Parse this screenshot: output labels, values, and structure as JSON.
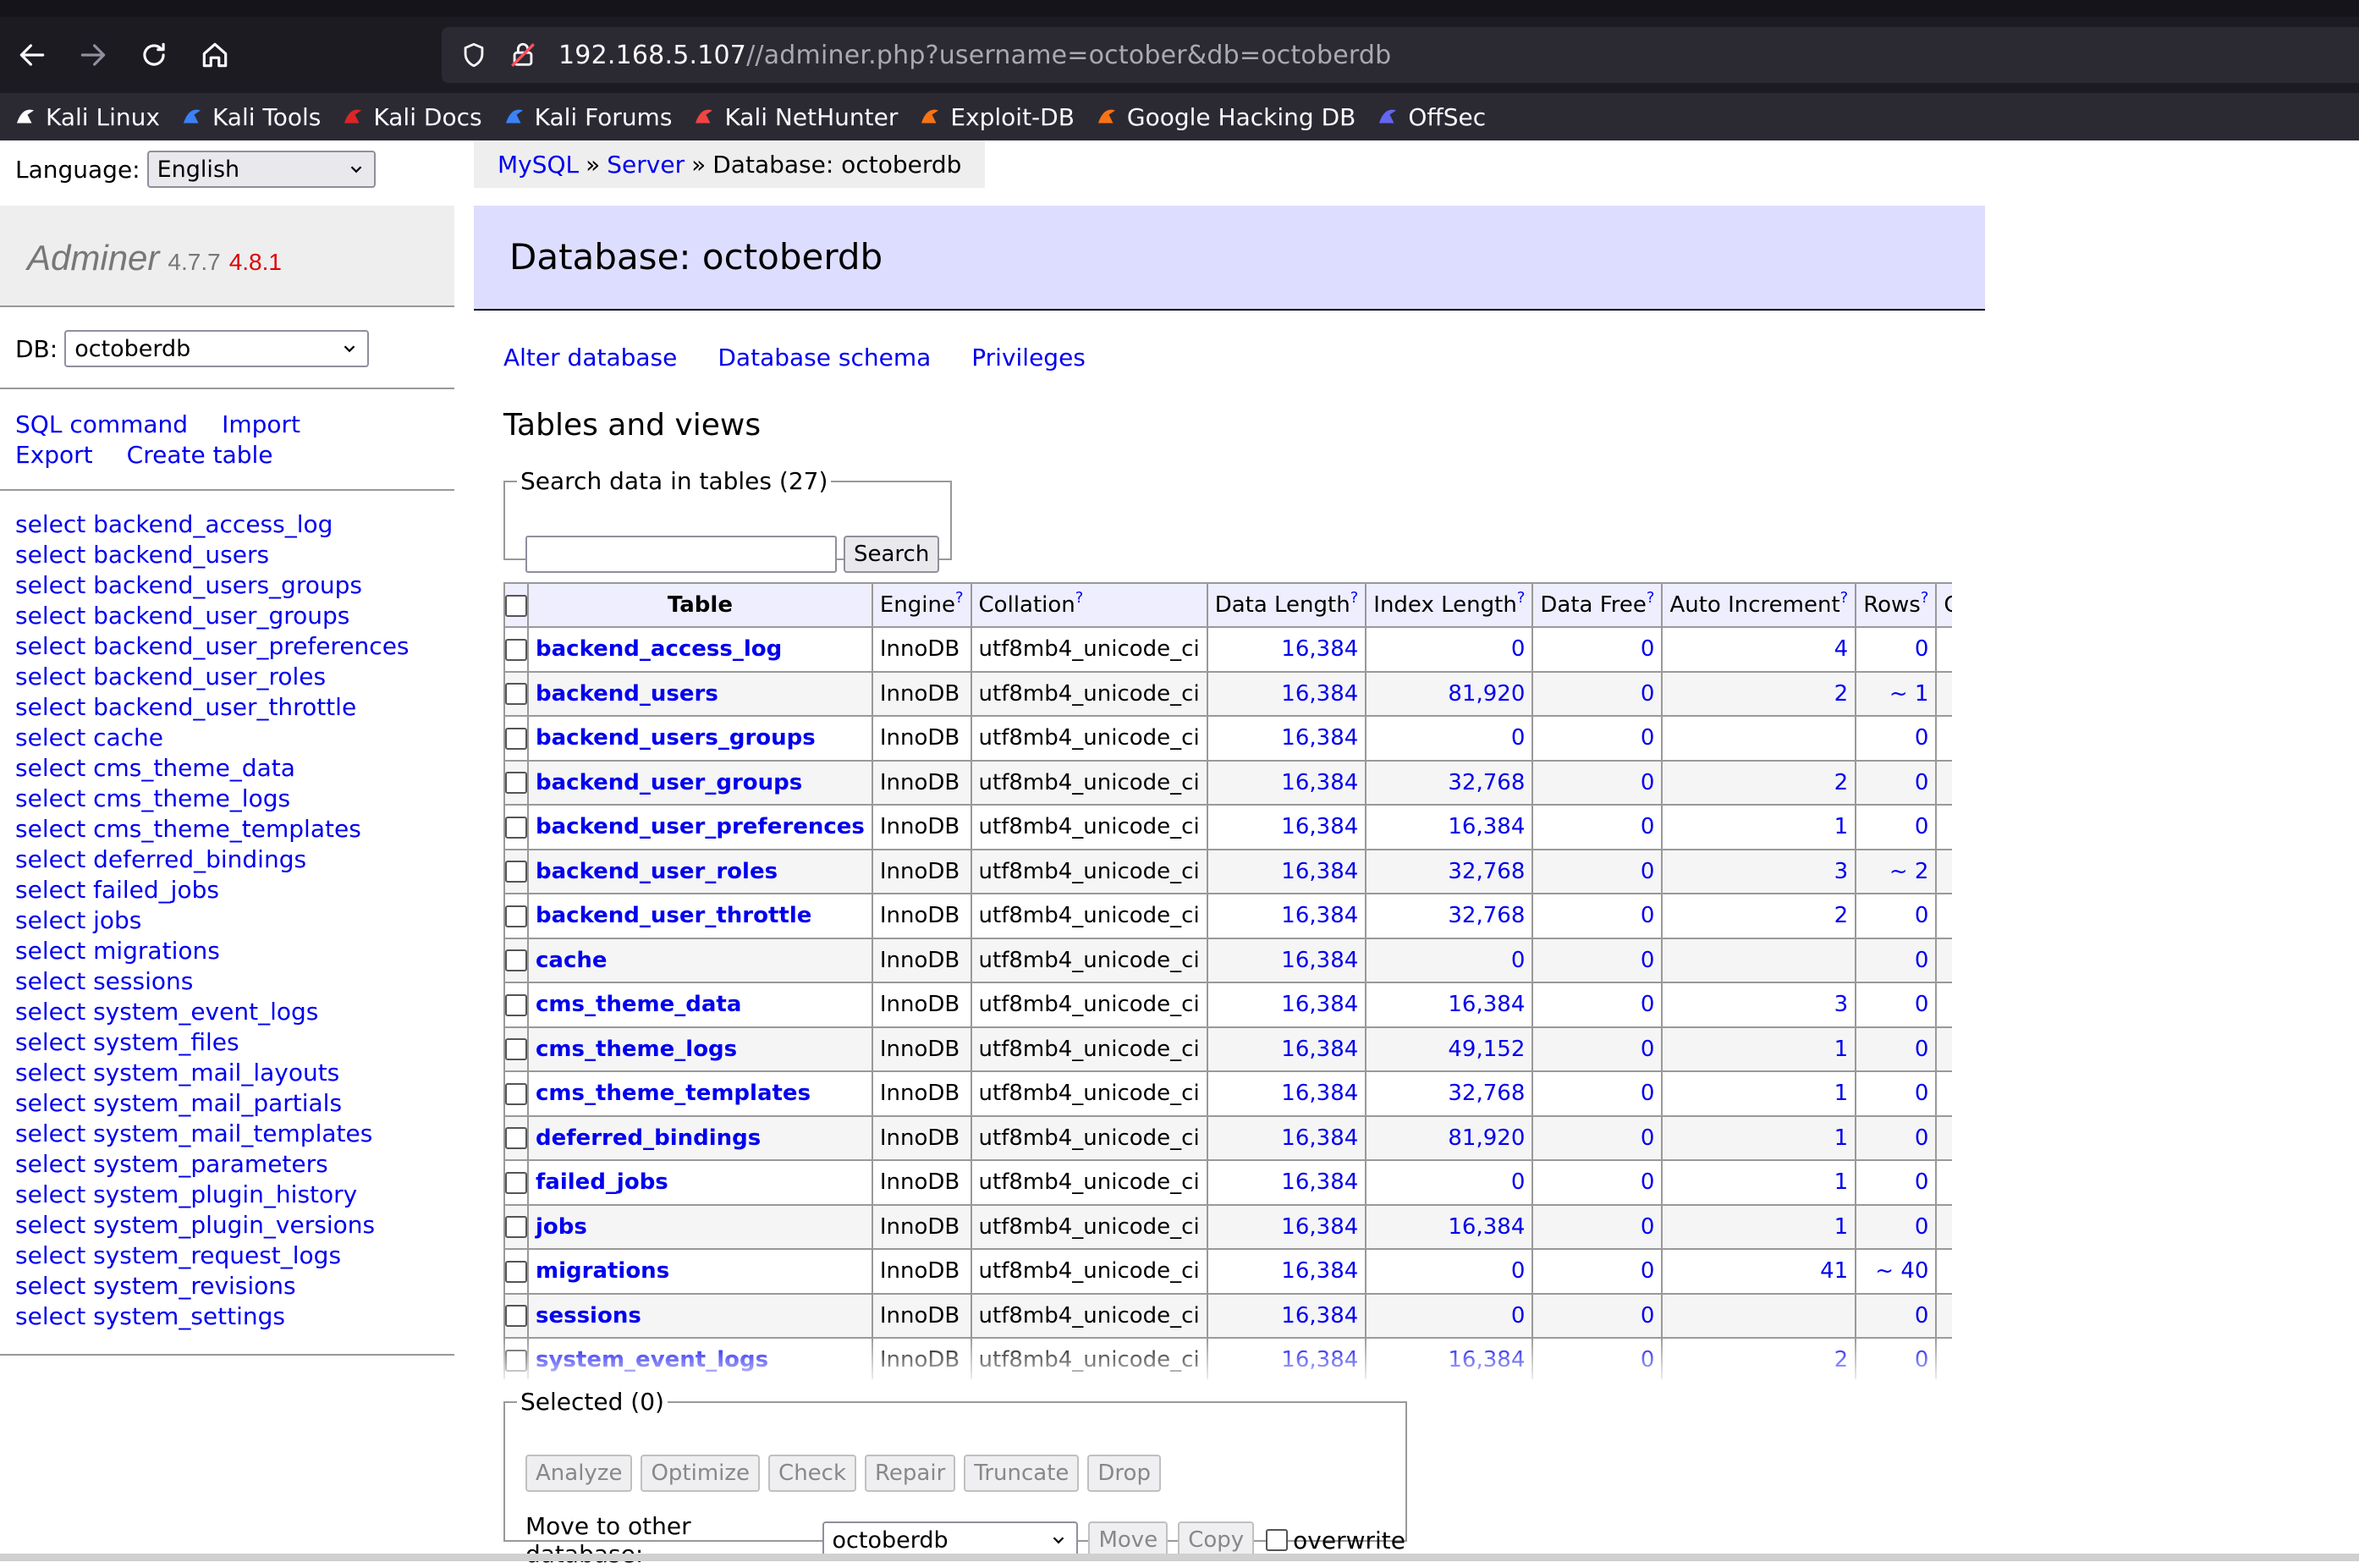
{
  "browser": {
    "url_host": "192.168.5.107",
    "url_path": "//adminer.php?username=october&db=octoberdb",
    "bookmarks": [
      {
        "label": "Kali Linux",
        "icon": "kali-dragon-icon",
        "color": "#ffffff"
      },
      {
        "label": "Kali Tools",
        "icon": "kali-tools-icon",
        "color": "#3b82f6"
      },
      {
        "label": "Kali Docs",
        "icon": "kali-docs-icon",
        "color": "#dc2626"
      },
      {
        "label": "Kali Forums",
        "icon": "kali-forums-icon",
        "color": "#3b82f6"
      },
      {
        "label": "Kali NetHunter",
        "icon": "nethunter-icon",
        "color": "#ef4444"
      },
      {
        "label": "Exploit-DB",
        "icon": "exploit-db-icon",
        "color": "#f97316"
      },
      {
        "label": "Google Hacking DB",
        "icon": "ghdb-icon",
        "color": "#f97316"
      },
      {
        "label": "OffSec",
        "icon": "offsec-icon",
        "color": "#6366f1"
      }
    ]
  },
  "sidebar": {
    "language_label": "Language:",
    "language_value": "English",
    "app_name": "Adminer",
    "version": "4.7.7",
    "new_version": "4.8.1",
    "db_label": "DB:",
    "db_value": "octoberdb",
    "commands": [
      "SQL command",
      "Import",
      "Export",
      "Create table"
    ],
    "tables": [
      "select backend_access_log",
      "select backend_users",
      "select backend_users_groups",
      "select backend_user_groups",
      "select backend_user_preferences",
      "select backend_user_roles",
      "select backend_user_throttle",
      "select cache",
      "select cms_theme_data",
      "select cms_theme_logs",
      "select cms_theme_templates",
      "select deferred_bindings",
      "select failed_jobs",
      "select jobs",
      "select migrations",
      "select sessions",
      "select system_event_logs",
      "select system_files",
      "select system_mail_layouts",
      "select system_mail_partials",
      "select system_mail_templates",
      "select system_parameters",
      "select system_plugin_history",
      "select system_plugin_versions",
      "select system_request_logs",
      "select system_revisions",
      "select system_settings"
    ]
  },
  "breadcrumb": {
    "mysql": "MySQL",
    "sep": "»",
    "server": "Server",
    "current": "Database: octoberdb"
  },
  "page": {
    "title": "Database: octoberdb",
    "links": [
      "Alter database",
      "Database schema",
      "Privileges"
    ],
    "section_title": "Tables and views",
    "search_legend": "Search data in tables (27)",
    "search_button": "Search"
  },
  "table": {
    "headers": [
      "Table",
      "Engine",
      "Collation",
      "Data Length",
      "Index Length",
      "Data Free",
      "Auto Increment",
      "Rows",
      "Comment"
    ],
    "help_mark": "?",
    "rows": [
      {
        "name": "backend_access_log",
        "engine": "InnoDB",
        "collation": "utf8mb4_unicode_ci",
        "data_length": "16,384",
        "index_length": "0",
        "data_free": "0",
        "auto_increment": "4",
        "rows": "0",
        "comment": ""
      },
      {
        "name": "backend_users",
        "engine": "InnoDB",
        "collation": "utf8mb4_unicode_ci",
        "data_length": "16,384",
        "index_length": "81,920",
        "data_free": "0",
        "auto_increment": "2",
        "rows": "~ 1",
        "comment": ""
      },
      {
        "name": "backend_users_groups",
        "engine": "InnoDB",
        "collation": "utf8mb4_unicode_ci",
        "data_length": "16,384",
        "index_length": "0",
        "data_free": "0",
        "auto_increment": "",
        "rows": "0",
        "comment": ""
      },
      {
        "name": "backend_user_groups",
        "engine": "InnoDB",
        "collation": "utf8mb4_unicode_ci",
        "data_length": "16,384",
        "index_length": "32,768",
        "data_free": "0",
        "auto_increment": "2",
        "rows": "0",
        "comment": ""
      },
      {
        "name": "backend_user_preferences",
        "engine": "InnoDB",
        "collation": "utf8mb4_unicode_ci",
        "data_length": "16,384",
        "index_length": "16,384",
        "data_free": "0",
        "auto_increment": "1",
        "rows": "0",
        "comment": ""
      },
      {
        "name": "backend_user_roles",
        "engine": "InnoDB",
        "collation": "utf8mb4_unicode_ci",
        "data_length": "16,384",
        "index_length": "32,768",
        "data_free": "0",
        "auto_increment": "3",
        "rows": "~ 2",
        "comment": ""
      },
      {
        "name": "backend_user_throttle",
        "engine": "InnoDB",
        "collation": "utf8mb4_unicode_ci",
        "data_length": "16,384",
        "index_length": "32,768",
        "data_free": "0",
        "auto_increment": "2",
        "rows": "0",
        "comment": ""
      },
      {
        "name": "cache",
        "engine": "InnoDB",
        "collation": "utf8mb4_unicode_ci",
        "data_length": "16,384",
        "index_length": "0",
        "data_free": "0",
        "auto_increment": "",
        "rows": "0",
        "comment": ""
      },
      {
        "name": "cms_theme_data",
        "engine": "InnoDB",
        "collation": "utf8mb4_unicode_ci",
        "data_length": "16,384",
        "index_length": "16,384",
        "data_free": "0",
        "auto_increment": "3",
        "rows": "0",
        "comment": ""
      },
      {
        "name": "cms_theme_logs",
        "engine": "InnoDB",
        "collation": "utf8mb4_unicode_ci",
        "data_length": "16,384",
        "index_length": "49,152",
        "data_free": "0",
        "auto_increment": "1",
        "rows": "0",
        "comment": ""
      },
      {
        "name": "cms_theme_templates",
        "engine": "InnoDB",
        "collation": "utf8mb4_unicode_ci",
        "data_length": "16,384",
        "index_length": "32,768",
        "data_free": "0",
        "auto_increment": "1",
        "rows": "0",
        "comment": ""
      },
      {
        "name": "deferred_bindings",
        "engine": "InnoDB",
        "collation": "utf8mb4_unicode_ci",
        "data_length": "16,384",
        "index_length": "81,920",
        "data_free": "0",
        "auto_increment": "1",
        "rows": "0",
        "comment": ""
      },
      {
        "name": "failed_jobs",
        "engine": "InnoDB",
        "collation": "utf8mb4_unicode_ci",
        "data_length": "16,384",
        "index_length": "0",
        "data_free": "0",
        "auto_increment": "1",
        "rows": "0",
        "comment": ""
      },
      {
        "name": "jobs",
        "engine": "InnoDB",
        "collation": "utf8mb4_unicode_ci",
        "data_length": "16,384",
        "index_length": "16,384",
        "data_free": "0",
        "auto_increment": "1",
        "rows": "0",
        "comment": ""
      },
      {
        "name": "migrations",
        "engine": "InnoDB",
        "collation": "utf8mb4_unicode_ci",
        "data_length": "16,384",
        "index_length": "0",
        "data_free": "0",
        "auto_increment": "41",
        "rows": "~ 40",
        "comment": ""
      },
      {
        "name": "sessions",
        "engine": "InnoDB",
        "collation": "utf8mb4_unicode_ci",
        "data_length": "16,384",
        "index_length": "0",
        "data_free": "0",
        "auto_increment": "",
        "rows": "0",
        "comment": ""
      },
      {
        "name": "system_event_logs",
        "engine": "InnoDB",
        "collation": "utf8mb4_unicode_ci",
        "data_length": "16,384",
        "index_length": "16,384",
        "data_free": "0",
        "auto_increment": "2",
        "rows": "0",
        "comment": ""
      }
    ]
  },
  "selected": {
    "legend": "Selected (0)",
    "buttons": [
      "Analyze",
      "Optimize",
      "Check",
      "Repair",
      "Truncate",
      "Drop"
    ],
    "move_label": "Move to other database:",
    "move_value": "octoberdb",
    "move_button": "Move",
    "copy_button": "Copy",
    "overwrite_label": "overwrite"
  }
}
